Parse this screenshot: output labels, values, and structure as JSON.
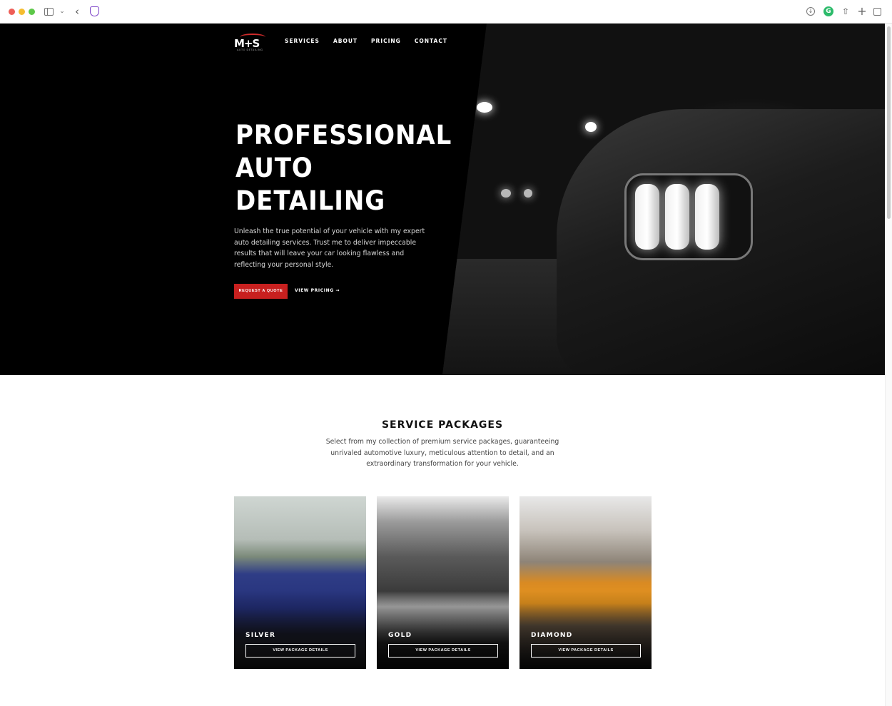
{
  "browser": {
    "icons": [
      "sidebar-icon",
      "chevron-down-icon",
      "back-icon",
      "shield-icon",
      "download-icon",
      "grammarly-icon",
      "share-icon",
      "plus-icon",
      "tabs-icon"
    ]
  },
  "site": {
    "logo_text": "M+S",
    "logo_subtext": "AUTO DETAILING",
    "nav": [
      "SERVICES",
      "ABOUT",
      "PRICING",
      "CONTACT"
    ]
  },
  "hero": {
    "title_lines": [
      "PROFESSIONAL",
      "AUTO",
      "DETAILING"
    ],
    "lead": "Unleash the true potential of your vehicle with my expert auto detailing services. Trust me to deliver impeccable results that will leave your car looking flawless and reflecting your personal style.",
    "primary_cta": "REQUEST A QUOTE",
    "secondary_cta": "VIEW PRICING →"
  },
  "packages": {
    "title": "SERVICE PACKAGES",
    "subtitle": "Select from my collection of premium service packages, guaranteeing unrivaled automotive luxury, meticulous attention to detail, and an extraordinary transformation for your vehicle.",
    "cards": [
      {
        "name": "SILVER",
        "button": "VIEW PACKAGE DETAILS"
      },
      {
        "name": "GOLD",
        "button": "VIEW PACKAGE DETAILS"
      },
      {
        "name": "DIAMOND",
        "button": "VIEW PACKAGE DETAILS"
      }
    ]
  },
  "colors": {
    "accent": "#c8201f",
    "hero_bg": "#000000",
    "page_bg": "#ffffff"
  }
}
